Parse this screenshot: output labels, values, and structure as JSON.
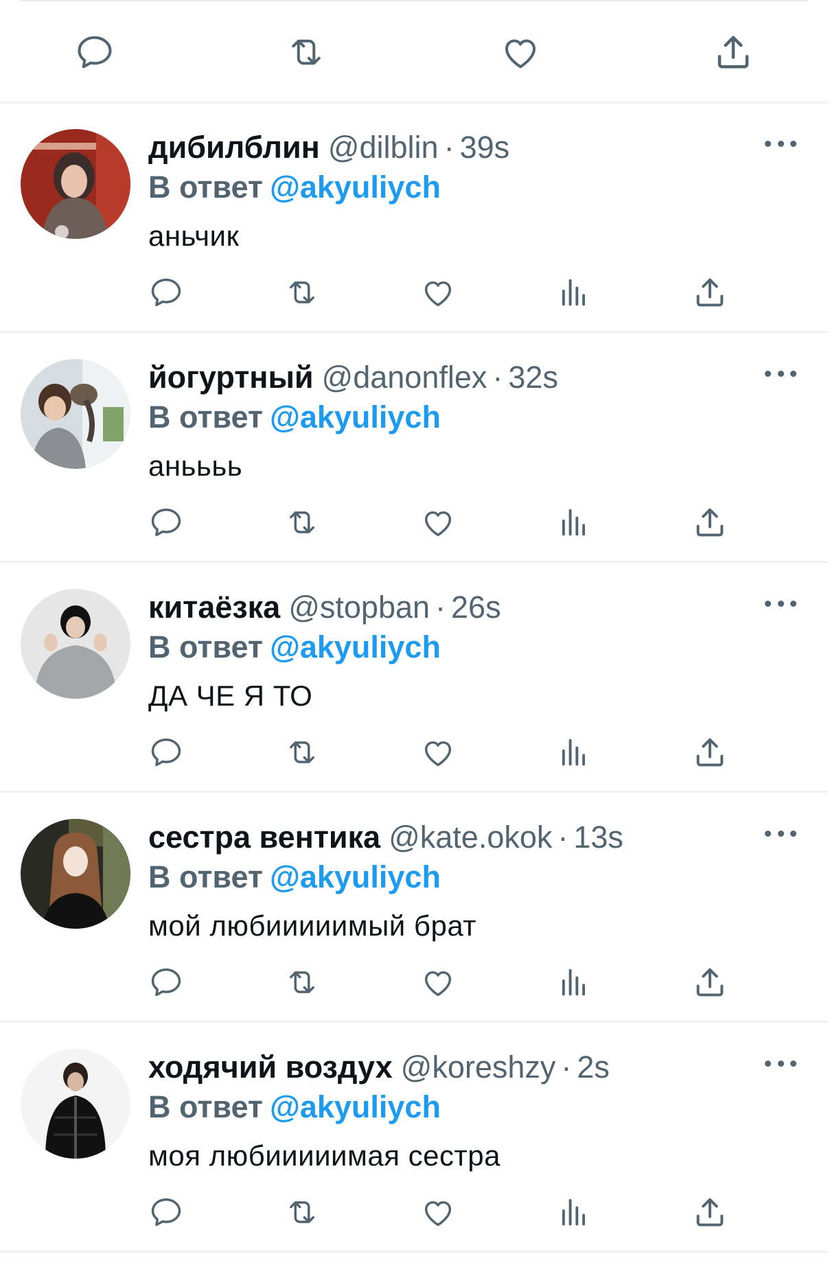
{
  "colors": {
    "text_primary": "#0f1419",
    "text_secondary": "#536471",
    "accent": "#1d9bf0",
    "divider": "#eff1f3"
  },
  "top_actions": {
    "icons": [
      "reply-icon",
      "retweet-icon",
      "like-icon",
      "share-icon"
    ]
  },
  "reply_prefix": "В ответ",
  "replies": [
    {
      "display_name": "дибилблин",
      "handle": "@dilblin",
      "separator": "·",
      "time": "39s",
      "reply_to": "@akyuliych",
      "text": "аньчик"
    },
    {
      "display_name": "йогуртный",
      "handle": "@danonflex",
      "separator": "·",
      "time": "32s",
      "reply_to": "@akyuliych",
      "text": "аньььь"
    },
    {
      "display_name": "китаёзка",
      "handle": "@stopban",
      "separator": "·",
      "time": "26s",
      "reply_to": "@akyuliych",
      "text": "ДА ЧЕ Я ТО"
    },
    {
      "display_name": "сестра вентика",
      "handle": "@kate.okok",
      "separator": "·",
      "time": "13s",
      "reply_to": "@akyuliych",
      "text": "мой любииииимый брат"
    },
    {
      "display_name": "ходячий воздух",
      "handle": "@koreshzy",
      "separator": "·",
      "time": "2s",
      "reply_to": "@akyuliych",
      "text": "моя любииииимая сестра"
    }
  ]
}
